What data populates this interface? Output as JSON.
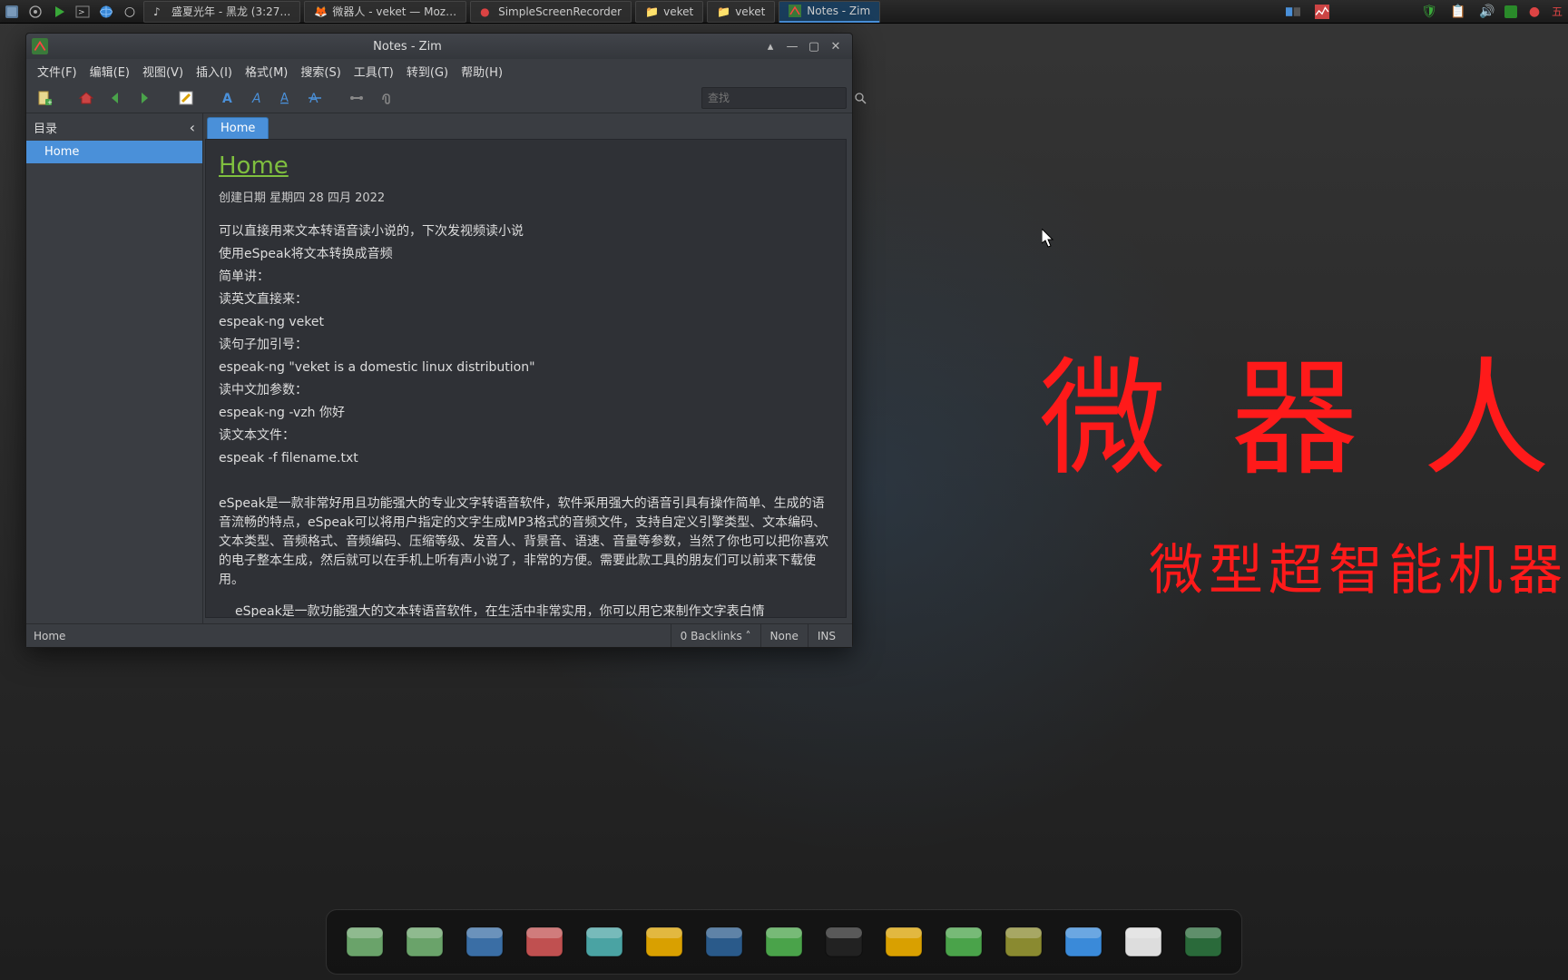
{
  "top_panel": {
    "tasks": [
      {
        "icon": "music",
        "label": "盛夏光年 - 黑龙 (3:27…"
      },
      {
        "icon": "firefox",
        "label": "微器人 - veket — Moz…"
      },
      {
        "icon": "record",
        "label": "SimpleScreenRecorder"
      },
      {
        "icon": "folder",
        "label": "veket"
      },
      {
        "icon": "folder",
        "label": "veket"
      },
      {
        "icon": "zim",
        "label": "Notes - Zim",
        "active": true
      }
    ],
    "ime": "五"
  },
  "wallpaper": {
    "title": "微 器 人",
    "subtitle": "微型超智能机器"
  },
  "zim": {
    "title": "Notes - Zim",
    "menus": [
      "文件(F)",
      "编辑(E)",
      "视图(V)",
      "插入(I)",
      "格式(M)",
      "搜索(S)",
      "工具(T)",
      "转到(G)",
      "帮助(H)"
    ],
    "search_placeholder": "查找",
    "sidebar_title": "目录",
    "tree_item": "Home",
    "tab": "Home",
    "page_title": "Home",
    "page_meta": "创建日期 星期四 28 四月 2022",
    "lines": [
      "可以直接用来文本转语音读小说的，下次发视频读小说",
      "使用eSpeak将文本转换成音频",
      "简单讲：",
      "读英文直接来：",
      "espeak-ng veket",
      "读句子加引号：",
      "espeak-ng \"veket is a domestic linux distribution\"",
      "读中文加参数：",
      "espeak-ng -vzh 你好",
      "读文本文件：",
      "espeak -f filename.txt",
      "",
      "eSpeak是一款非常好用且功能强大的专业文字转语音软件，软件采用强大的语音引具有操作简单、生成的语音流畅的特点，eSpeak可以将用户指定的文字生成MP3格式的音频文件，支持自定义引擎类型、文本编码、文本类型、音频格式、音频编码、压缩等级、发音人、背景音、语速、音量等参数，当然了你也可以把你喜欢的电子整本生成，然后就可以在手机上听有声小说了，非常的方便。需要此款工具的朋友们可以前来下载使用。"
    ],
    "lines_indent": [
      "eSpeak是一款功能强大的文本转语音软件，在生活中非常实用，你可以用它来制作文字表白情"
    ],
    "status": {
      "path": "Home",
      "backlinks": "0 Backlinks",
      "none": "None",
      "ins": "INS"
    }
  },
  "dock": {
    "items": [
      {
        "name": "files-1",
        "color": "#6aa36a"
      },
      {
        "name": "files-2",
        "color": "#6aa36a"
      },
      {
        "name": "monitor",
        "color": "#3a6ea5"
      },
      {
        "name": "app-tool",
        "color": "#c05050"
      },
      {
        "name": "pen",
        "color": "#4aa3a3"
      },
      {
        "name": "palette",
        "color": "#d9a000"
      },
      {
        "name": "audio",
        "color": "#2a5a8a"
      },
      {
        "name": "app-misc",
        "color": "#4aa34a"
      },
      {
        "name": "tux",
        "color": "#222"
      },
      {
        "name": "folder",
        "color": "#d9a000"
      },
      {
        "name": "chart",
        "color": "#4aa34a"
      },
      {
        "name": "help",
        "color": "#8a8a30"
      },
      {
        "name": "share",
        "color": "#3a8ad9"
      },
      {
        "name": "brightness",
        "color": "#ddd"
      },
      {
        "name": "globe",
        "color": "#2a6a3a"
      }
    ]
  }
}
